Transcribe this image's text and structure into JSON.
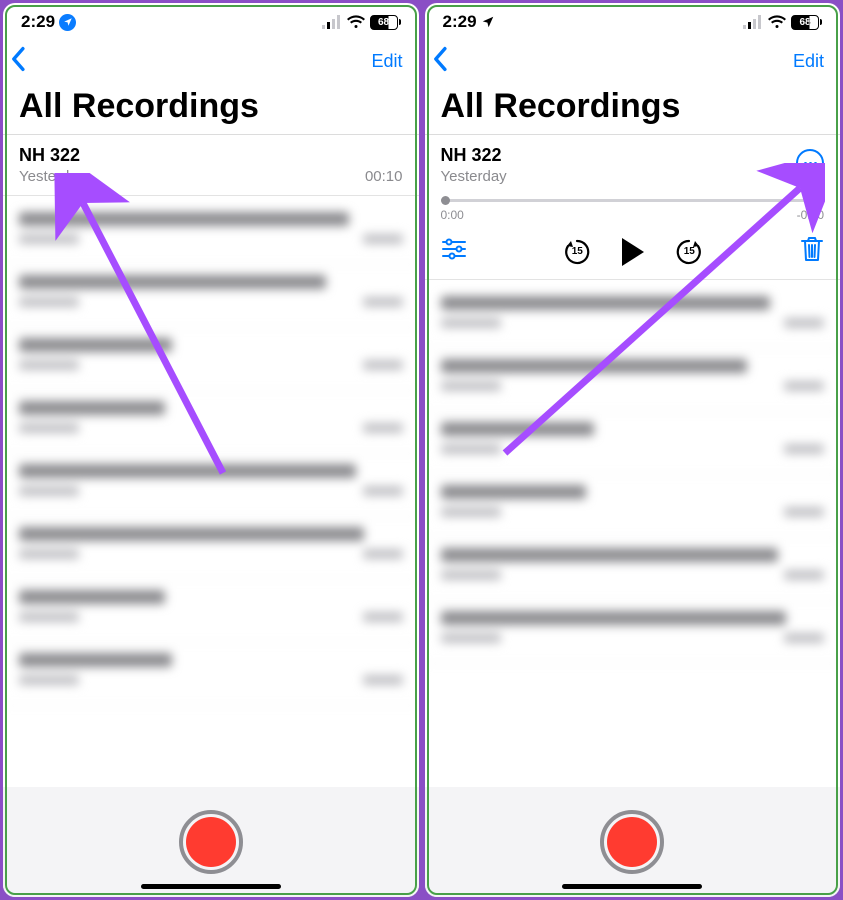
{
  "status": {
    "time": "2:29",
    "battery_pct": "68"
  },
  "nav": {
    "edit_label": "Edit"
  },
  "title": "All Recordings",
  "recording": {
    "name": "NH 322",
    "date": "Yesterday",
    "duration": "00:10"
  },
  "playback": {
    "elapsed": "0:00",
    "remaining": "-0:10",
    "skip_amount": "15"
  }
}
